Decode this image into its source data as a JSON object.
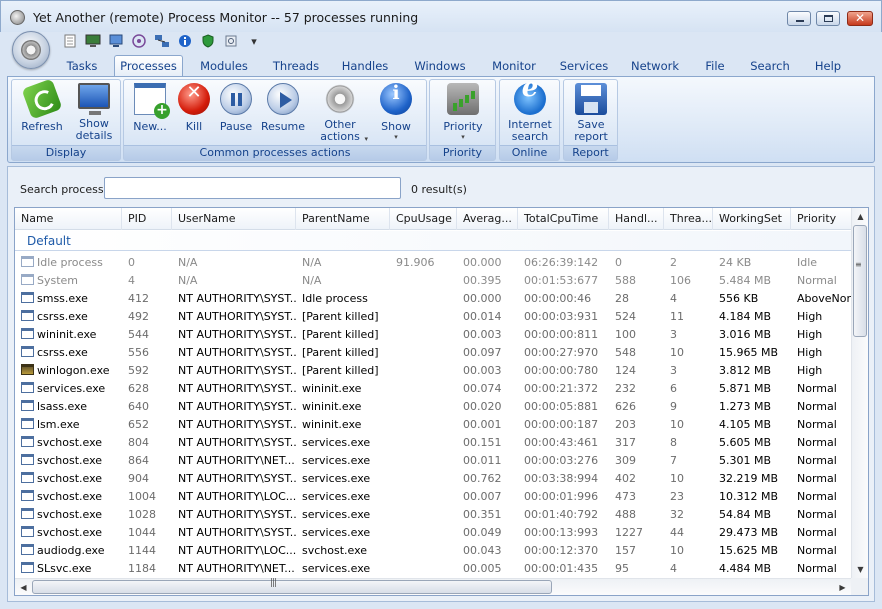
{
  "window": {
    "title": "Yet Another (remote) Process Monitor -- 57 processes running"
  },
  "quick_access": [
    "document-icon",
    "monitor-icon",
    "computer-icon",
    "target-icon",
    "network-icon",
    "info-icon",
    "shield-icon",
    "tools-icon"
  ],
  "quick_access_more": "▾",
  "tabs": [
    "Tasks",
    "Processes",
    "Modules",
    "Threads",
    "Handles",
    "Windows",
    "Monitor",
    "Services",
    "Network",
    "File",
    "Search",
    "Help"
  ],
  "active_tab": "Processes",
  "ribbon": {
    "display": {
      "label": "Display",
      "refresh": "Refresh",
      "show_details_1": "Show",
      "show_details_2": "details"
    },
    "common": {
      "label": "Common processes actions",
      "new": "New...",
      "kill": "Kill",
      "pause": "Pause",
      "resume": "Resume",
      "other_actions_1": "Other",
      "other_actions_2": "actions",
      "show": "Show"
    },
    "priority": {
      "label": "Priority",
      "priority": "Priority"
    },
    "online": {
      "label": "Online",
      "internet_1": "Internet",
      "internet_2": "search"
    },
    "report": {
      "label": "Report",
      "save_1": "Save",
      "save_2": "report"
    }
  },
  "search": {
    "label": "Search process",
    "value": "",
    "result_count": "0 result(s)"
  },
  "table": {
    "columns": [
      "Name",
      "PID",
      "UserName",
      "ParentName",
      "CpuUsage",
      "Averag...",
      "TotalCpuTime",
      "Handl...",
      "Threa...",
      "WorkingSet",
      "Priority"
    ],
    "group": "Default",
    "rows": [
      {
        "name": "Idle process",
        "pid": "0",
        "user": "N/A",
        "parent": "N/A",
        "cpu": "91.906",
        "avg": "00.000",
        "total": "06:26:39:142",
        "handles": "0",
        "threads": "2",
        "ws": "24 KB",
        "priority": "Idle",
        "dim": true,
        "icon": "window"
      },
      {
        "name": "System",
        "pid": "4",
        "user": "N/A",
        "parent": "N/A",
        "cpu": "",
        "avg": "00.395",
        "total": "00:01:53:677",
        "handles": "588",
        "threads": "106",
        "ws": "5.484 MB",
        "priority": "Normal",
        "dim": true,
        "icon": "window"
      },
      {
        "name": "smss.exe",
        "pid": "412",
        "user": "NT AUTHORITY\\SYST...",
        "parent": "Idle process",
        "cpu": "",
        "avg": "00.000",
        "total": "00:00:00:46",
        "handles": "28",
        "threads": "4",
        "ws": "556 KB",
        "priority": "AboveNorr",
        "dim": false,
        "icon": "window"
      },
      {
        "name": "csrss.exe",
        "pid": "492",
        "user": "NT AUTHORITY\\SYST...",
        "parent": "[Parent killed]",
        "cpu": "",
        "avg": "00.014",
        "total": "00:00:03:931",
        "handles": "524",
        "threads": "11",
        "ws": "4.184 MB",
        "priority": "High",
        "dim": false,
        "icon": "window"
      },
      {
        "name": "wininit.exe",
        "pid": "544",
        "user": "NT AUTHORITY\\SYST...",
        "parent": "[Parent killed]",
        "cpu": "",
        "avg": "00.003",
        "total": "00:00:00:811",
        "handles": "100",
        "threads": "3",
        "ws": "3.016 MB",
        "priority": "High",
        "dim": false,
        "icon": "window"
      },
      {
        "name": "csrss.exe",
        "pid": "556",
        "user": "NT AUTHORITY\\SYST...",
        "parent": "[Parent killed]",
        "cpu": "",
        "avg": "00.097",
        "total": "00:00:27:970",
        "handles": "548",
        "threads": "10",
        "ws": "15.965 MB",
        "priority": "High",
        "dim": false,
        "icon": "window"
      },
      {
        "name": "winlogon.exe",
        "pid": "592",
        "user": "NT AUTHORITY\\SYST...",
        "parent": "[Parent killed]",
        "cpu": "",
        "avg": "00.003",
        "total": "00:00:00:780",
        "handles": "124",
        "threads": "3",
        "ws": "3.812 MB",
        "priority": "High",
        "dim": false,
        "icon": "logon"
      },
      {
        "name": "services.exe",
        "pid": "628",
        "user": "NT AUTHORITY\\SYST...",
        "parent": "wininit.exe",
        "cpu": "",
        "avg": "00.074",
        "total": "00:00:21:372",
        "handles": "232",
        "threads": "6",
        "ws": "5.871 MB",
        "priority": "Normal",
        "dim": false,
        "icon": "window"
      },
      {
        "name": "lsass.exe",
        "pid": "640",
        "user": "NT AUTHORITY\\SYST...",
        "parent": "wininit.exe",
        "cpu": "",
        "avg": "00.020",
        "total": "00:00:05:881",
        "handles": "626",
        "threads": "9",
        "ws": "1.273 MB",
        "priority": "Normal",
        "dim": false,
        "icon": "window"
      },
      {
        "name": "lsm.exe",
        "pid": "652",
        "user": "NT AUTHORITY\\SYST...",
        "parent": "wininit.exe",
        "cpu": "",
        "avg": "00.001",
        "total": "00:00:00:187",
        "handles": "203",
        "threads": "10",
        "ws": "4.105 MB",
        "priority": "Normal",
        "dim": false,
        "icon": "window"
      },
      {
        "name": "svchost.exe",
        "pid": "804",
        "user": "NT AUTHORITY\\SYST...",
        "parent": "services.exe",
        "cpu": "",
        "avg": "00.151",
        "total": "00:00:43:461",
        "handles": "317",
        "threads": "8",
        "ws": "5.605 MB",
        "priority": "Normal",
        "dim": false,
        "icon": "window"
      },
      {
        "name": "svchost.exe",
        "pid": "864",
        "user": "NT AUTHORITY\\NET...",
        "parent": "services.exe",
        "cpu": "",
        "avg": "00.011",
        "total": "00:00:03:276",
        "handles": "309",
        "threads": "7",
        "ws": "5.301 MB",
        "priority": "Normal",
        "dim": false,
        "icon": "window"
      },
      {
        "name": "svchost.exe",
        "pid": "904",
        "user": "NT AUTHORITY\\SYST...",
        "parent": "services.exe",
        "cpu": "",
        "avg": "00.762",
        "total": "00:03:38:994",
        "handles": "402",
        "threads": "10",
        "ws": "32.219 MB",
        "priority": "Normal",
        "dim": false,
        "icon": "window"
      },
      {
        "name": "svchost.exe",
        "pid": "1004",
        "user": "NT AUTHORITY\\LOC...",
        "parent": "services.exe",
        "cpu": "",
        "avg": "00.007",
        "total": "00:00:01:996",
        "handles": "473",
        "threads": "23",
        "ws": "10.312 MB",
        "priority": "Normal",
        "dim": false,
        "icon": "window"
      },
      {
        "name": "svchost.exe",
        "pid": "1028",
        "user": "NT AUTHORITY\\SYST...",
        "parent": "services.exe",
        "cpu": "",
        "avg": "00.351",
        "total": "00:01:40:792",
        "handles": "488",
        "threads": "32",
        "ws": "54.84 MB",
        "priority": "Normal",
        "dim": false,
        "icon": "window"
      },
      {
        "name": "svchost.exe",
        "pid": "1044",
        "user": "NT AUTHORITY\\SYST...",
        "parent": "services.exe",
        "cpu": "",
        "avg": "00.049",
        "total": "00:00:13:993",
        "handles": "1227",
        "threads": "44",
        "ws": "29.473 MB",
        "priority": "Normal",
        "dim": false,
        "icon": "window"
      },
      {
        "name": "audiodg.exe",
        "pid": "1144",
        "user": "NT AUTHORITY\\LOC...",
        "parent": "svchost.exe",
        "cpu": "",
        "avg": "00.043",
        "total": "00:00:12:370",
        "handles": "157",
        "threads": "10",
        "ws": "15.625 MB",
        "priority": "Normal",
        "dim": false,
        "icon": "window"
      },
      {
        "name": "SLsvc.exe",
        "pid": "1184",
        "user": "NT AUTHORITY\\NET...",
        "parent": "services.exe",
        "cpu": "",
        "avg": "00.005",
        "total": "00:00:01:435",
        "handles": "95",
        "threads": "4",
        "ws": "4.484 MB",
        "priority": "Normal",
        "dim": false,
        "icon": "window"
      }
    ]
  },
  "scrollbar": {
    "up": "▲",
    "down": "▼",
    "left": "◀",
    "right": "▶",
    "v_grip": "≡",
    "h_grip": "|||"
  }
}
